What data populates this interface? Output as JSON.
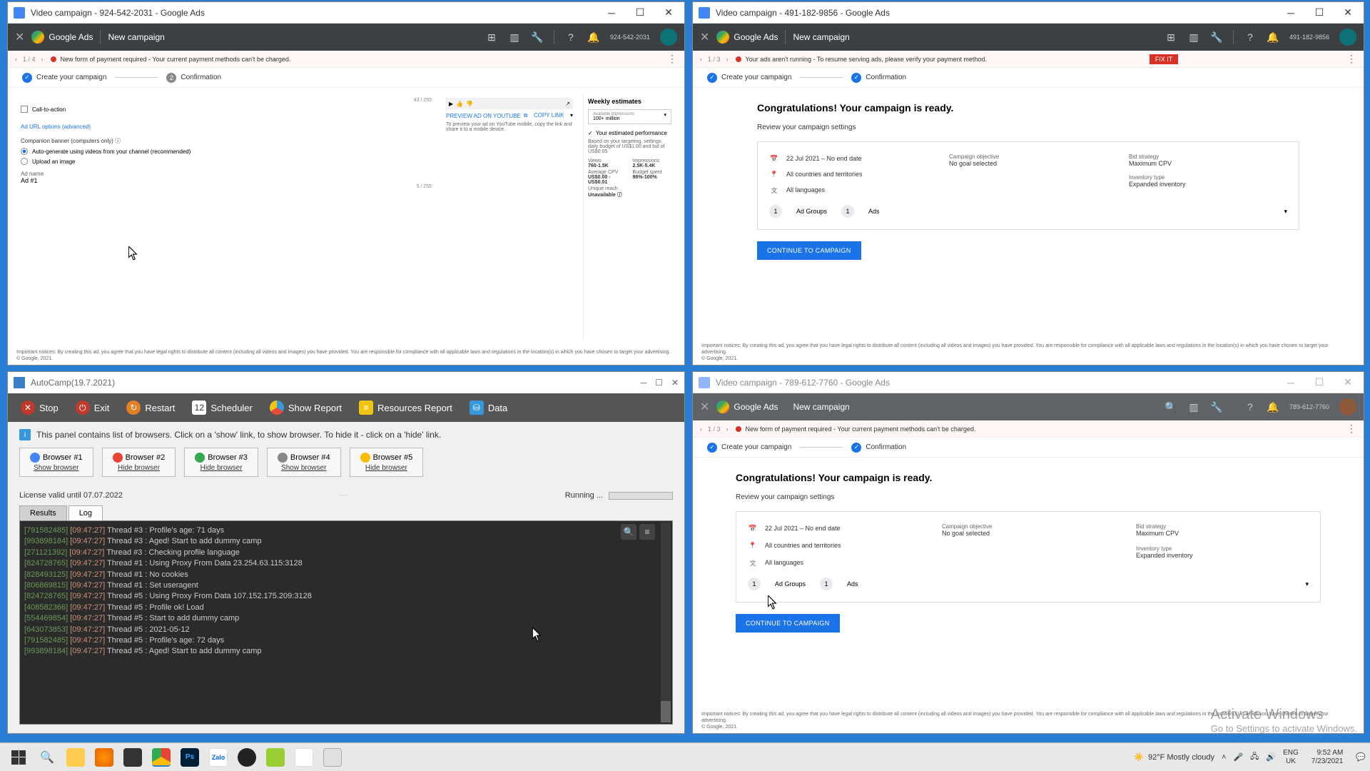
{
  "win1": {
    "title": "Video campaign - 924-542-2031 - Google Ads",
    "newCampaign": "New campaign",
    "alert": "New form of payment required - Your current payment methods can't be charged.",
    "pager": "1 / 4",
    "step1": "Create your campaign",
    "step2": "Confirmation",
    "cta": "Call-to-action",
    "adurl": "Ad URL options (advanced)",
    "compBanner": "Companion banner (computers only)",
    "autoGen": "Auto-generate using videos from your channel (recommended)",
    "upload": "Upload an image",
    "adname": "Ad name",
    "adnameVal": "Ad #1",
    "counter1": "43 / 255",
    "counter2": "5 / 255",
    "previewTitle": "PREVIEW AD ON YOUTUBE",
    "copyLink": "COPY LINK",
    "previewDesc": "To preview your ad on YouTube mobile, copy the link and share it to a mobile device.",
    "weeklyEst": "Weekly estimates",
    "availImp": "Available impressions",
    "availImpVal": "100+ million",
    "yourPerf": "Your estimated performance",
    "perfDesc": "Based on your targeting, settings, daily budget of US$1.00 and bid of US$0.05",
    "views": "Views",
    "viewsVal": "760-1.5K",
    "impressions": "Impressions",
    "impVal": "2.5K-5.4K",
    "avgCpv": "Average CPV",
    "avgCpvVal": "US$0.00 - US$0.01",
    "budget": "Budget spent",
    "budgetVal": "98%-100%",
    "reach": "Unique reach",
    "reachVal": "Unavailable",
    "legal": "Important notices: By creating this ad, you agree that you have legal rights to distribute all content (including all videos and images) you have provided. You are responsible for compliance with all applicable laws and regulations in the location(s) in which you have chosen to target your advertising.",
    "copyright": "© Google, 2021."
  },
  "win2": {
    "title": "Video campaign - 491-182-9856 - Google Ads",
    "newCampaign": "New campaign",
    "alert": "Your ads aren't running - To resume serving ads, please verify your payment method.",
    "fixit": "FIX IT",
    "pager": "1 / 3",
    "step1": "Create your campaign",
    "step2": "Confirmation",
    "congrats": "Congratulations! Your campaign is ready.",
    "review": "Review your campaign settings",
    "dateRange": "22 Jul 2021 – No end date",
    "countries": "All countries and territories",
    "langs": "All languages",
    "campObj": "Campaign objective",
    "campObjVal": "No goal selected",
    "bidStrat": "Bid strategy",
    "bidStratVal": "Maximum CPV",
    "invType": "Inventory type",
    "invTypeVal": "Expanded inventory",
    "adGroups": "Ad Groups",
    "ads": "Ads",
    "one": "1",
    "continue": "CONTINUE TO CAMPAIGN",
    "legal": "Important notices: By creating this ad, you agree that you have legal rights to distribute all content (including all videos and images) you have provided. You are responsible for compliance with all applicable laws and regulations in the location(s) in which you have chosen to target your advertising.",
    "copyright": "© Google, 2021."
  },
  "win3": {
    "title": "AutoCamp(19.7.2021)",
    "stop": "Stop",
    "exit": "Exit",
    "restart": "Restart",
    "scheduler": "Scheduler",
    "showReport": "Show Report",
    "resReport": "Resources Report",
    "data": "Data",
    "info": "This panel contains list of browsers. Click on a 'show' link, to show browser. To hide it - click on a 'hide' link.",
    "browsers": [
      {
        "name": "Browser #1",
        "link": "Show browser",
        "color": "#4285f4"
      },
      {
        "name": "Browser #2",
        "link": "Hide browser",
        "color": "#ea4335"
      },
      {
        "name": "Browser #3",
        "link": "Hide browser",
        "color": "#34a853"
      },
      {
        "name": "Browser #4",
        "link": "Show browser",
        "color": "#888"
      },
      {
        "name": "Browser #5",
        "link": "Hide browser",
        "color": "#fbbc05"
      }
    ],
    "license": "License valid until 07.07.2022",
    "running": "Running ...",
    "tabResults": "Results",
    "tabLog": "Log",
    "log": [
      {
        "id": "[791582485]",
        "t": "[09:47:27]",
        "msg": "Thread #3 : Profile's age: 71 days"
      },
      {
        "id": "[993898184]",
        "t": "[09:47:27]",
        "msg": "Thread #3 : Aged! Start to add dummy camp"
      },
      {
        "id": "[271121392]",
        "t": "[09:47:27]",
        "msg": "Thread #3 : Checking profile language"
      },
      {
        "id": "[824728765]",
        "t": "[09:47:27]",
        "msg": "Thread #1 : Using Proxy From Data 23.254.63.115:3128"
      },
      {
        "id": "[828493125]",
        "t": "[09:47:27]",
        "msg": "Thread #1 : No cookies"
      },
      {
        "id": "[806869815]",
        "t": "[09:47:27]",
        "msg": "Thread #1 : Set useragent"
      },
      {
        "id": "[824728765]",
        "t": "[09:47:27]",
        "msg": "Thread #5 : Using Proxy From Data 107.152.175.209:3128"
      },
      {
        "id": "[408582366]",
        "t": "[09:47:27]",
        "msg": "Thread #5 : Profile ok! Load"
      },
      {
        "id": "[554469854]",
        "t": "[09:47:27]",
        "msg": "Thread #5 : Start to add dummy camp"
      },
      {
        "id": "[643073853]",
        "t": "[09:47:27]",
        "msg": "Thread #5 : 2021-05-12"
      },
      {
        "id": "[791582485]",
        "t": "[09:47:27]",
        "msg": "Thread #5 : Profile's age: 72 days"
      },
      {
        "id": "[993898184]",
        "t": "[09:47:27]",
        "msg": "Thread #5 : Aged! Start to add dummy camp"
      }
    ]
  },
  "win4": {
    "title": "Video campaign - 789-612-7760 - Google Ads",
    "newCampaign": "New campaign",
    "alert": "New form of payment required - Your current payment methods can't be charged.",
    "pager": "1 / 3",
    "step1": "Create your campaign",
    "step2": "Confirmation",
    "congrats": "Congratulations! Your campaign is ready.",
    "review": "Review your campaign settings",
    "dateRange": "22 Jul 2021 – No end date",
    "countries": "All countries and territories",
    "langs": "All languages",
    "campObj": "Campaign objective",
    "campObjVal": "No goal selected",
    "bidStrat": "Bid strategy",
    "bidStratVal": "Maximum CPV",
    "invType": "Inventory type",
    "invTypeVal": "Expanded inventory",
    "adGroups": "Ad Groups",
    "ads": "Ads",
    "one": "1",
    "continue": "CONTINUE TO CAMPAIGN",
    "legal": "Important notices: By creating this ad, you agree that you have legal rights to distribute all content (including all videos and images) you have provided. You are responsible for compliance with all applicable laws and regulations in the location(s) in which you have chosen to target your advertising.",
    "copyright": "© Google, 2021."
  },
  "taskbar": {
    "weather": "92°F  Mostly cloudy",
    "lang1": "ENG",
    "lang2": "UK",
    "time": "9:52 AM",
    "date": "7/23/2021"
  },
  "watermark": {
    "title": "Activate Windows",
    "sub": "Go to Settings to activate Windows."
  },
  "adsLogo": "Google Ads"
}
